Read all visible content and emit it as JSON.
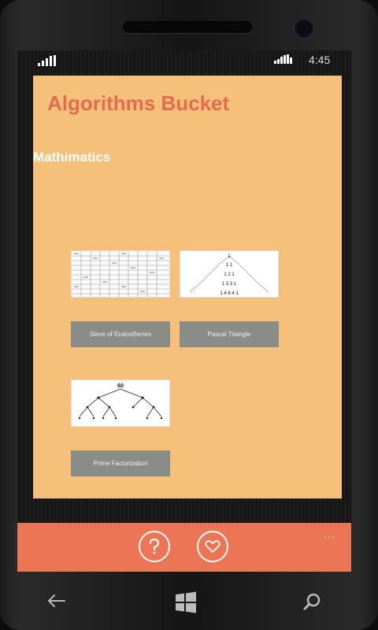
{
  "status": {
    "time": "4:45"
  },
  "app": {
    "title": "Algorithms Bucket",
    "section": "Mathimatics"
  },
  "colors": {
    "page_bg": "#f4c07a",
    "title": "#e36b50",
    "app_bar": "#ec7556",
    "button_bg": "#8a8c88"
  },
  "tiles": [
    {
      "label": "Sieve of Eratosthenes",
      "thumbnail": "number-grid-image"
    },
    {
      "label": "Pascal Triangle",
      "thumbnail": "pascal-triangle-image"
    },
    {
      "label": "Prime Factorization",
      "thumbnail": "factor-tree-image"
    }
  ],
  "pascal_numbers": [
    "1",
    "1 1",
    "1 2 1",
    "1 3 3 1",
    "1 4 6 4 1"
  ],
  "factor_tree_root": "60",
  "appbar": {
    "help_icon": "question-circle-icon",
    "favorite_icon": "heart-circle-icon",
    "more": "..."
  },
  "nav": {
    "back": "back-arrow-icon",
    "start": "windows-logo-icon",
    "search": "search-icon"
  }
}
